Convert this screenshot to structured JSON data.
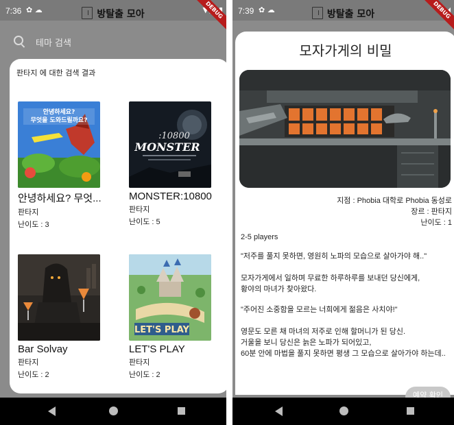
{
  "left": {
    "status": {
      "time": "7:36",
      "icons": "✿ ☁",
      "right_icons": "▼◢ ▮"
    },
    "app_title": "방탈출 모아",
    "debug_label": "DEBUG",
    "search": {
      "placeholder": "테마 검색"
    },
    "results_title": "판타지 에 대한 검색 결과",
    "themes": [
      {
        "name": "안녕하세요? 무엇...",
        "genre": "판타지",
        "difficulty": "난이도 : 3",
        "poster_text": "안녕하세요? 무엇을 도와드릴까요?"
      },
      {
        "name": "MONSTER:10800",
        "genre": "판타지",
        "difficulty": "난이도 : 5",
        "poster_text": ":10800 MONSTER"
      },
      {
        "name": "Bar Solvay",
        "genre": "판타지",
        "difficulty": "난이도 : 2"
      },
      {
        "name": "LET'S PLAY",
        "genre": "판타지",
        "difficulty": "난이도 : 2",
        "poster_text": "LET'S PLAY"
      }
    ]
  },
  "right": {
    "status": {
      "time": "7:39",
      "icons": "✿ ☁",
      "right_icons": "▼◢"
    },
    "app_title": "방탈출 모아",
    "debug_label": "DEBUG",
    "detail_title": "모자가게의 비밀",
    "location": "지점 :  Phobia 대학로  Phobia 동성로",
    "genre": "장르 : 판타지",
    "difficulty": "난이도 : 1",
    "players": "2-5 players",
    "story": [
      "\"저주를 풀지 못하면, 영원히 노파의 모습으로 살아가야 해..\"",
      "모자가게에서 일하며 무료한 하루하루를 보내던 당신에게,",
      "황야의 마녀가 찾아왔다.",
      "\"주어진 소중함을 모르는 너희에게 젊음은 사치야!\"",
      "영문도 모른 채 마녀의 저주로 인해 할머니가 된 당신.",
      "거울을 보니 당신은 늙은 노파가 되어있고,",
      "60분 안에 마법을 풀지 못하면 평생 그 모습으로 살아가야 하는데.."
    ],
    "reserve_button": "예약 확인"
  }
}
